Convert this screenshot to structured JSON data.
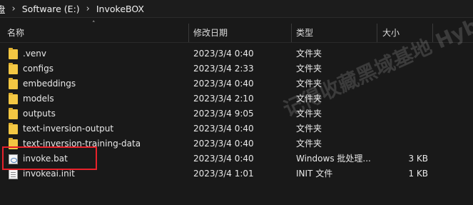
{
  "breadcrumb": {
    "partial_first": "盘",
    "items": [
      "Software (E:)",
      "InvokeBOX"
    ]
  },
  "columns": {
    "name": "名称",
    "modified": "修改日期",
    "type": "类型",
    "size": "大小"
  },
  "files": [
    {
      "icon": "folder-icon",
      "name": ".venv",
      "modified": "2023/3/4 0:40",
      "type": "文件夹",
      "size": ""
    },
    {
      "icon": "folder-icon",
      "name": "configs",
      "modified": "2023/3/4 2:33",
      "type": "文件夹",
      "size": ""
    },
    {
      "icon": "folder-icon",
      "name": "embeddings",
      "modified": "2023/3/4 0:40",
      "type": "文件夹",
      "size": ""
    },
    {
      "icon": "folder-icon",
      "name": "models",
      "modified": "2023/3/4 2:10",
      "type": "文件夹",
      "size": ""
    },
    {
      "icon": "folder-icon",
      "name": "outputs",
      "modified": "2023/3/4 9:05",
      "type": "文件夹",
      "size": ""
    },
    {
      "icon": "folder-icon",
      "name": "text-inversion-output",
      "modified": "2023/3/4 0:40",
      "type": "文件夹",
      "size": ""
    },
    {
      "icon": "folder-icon",
      "name": "text-inversion-training-data",
      "modified": "2023/3/4 0:40",
      "type": "文件夹",
      "size": ""
    },
    {
      "icon": "batch-file-icon",
      "name": "invoke.bat",
      "modified": "2023/3/4 0:40",
      "type": "Windows 批处理...",
      "size": "3 KB"
    },
    {
      "icon": "ini-file-icon",
      "name": "invokeai.init",
      "modified": "2023/3/4 1:01",
      "type": "INIT 文件",
      "size": "1 KB"
    }
  ],
  "watermark": "记得收藏黑域基地  Hybase.com"
}
